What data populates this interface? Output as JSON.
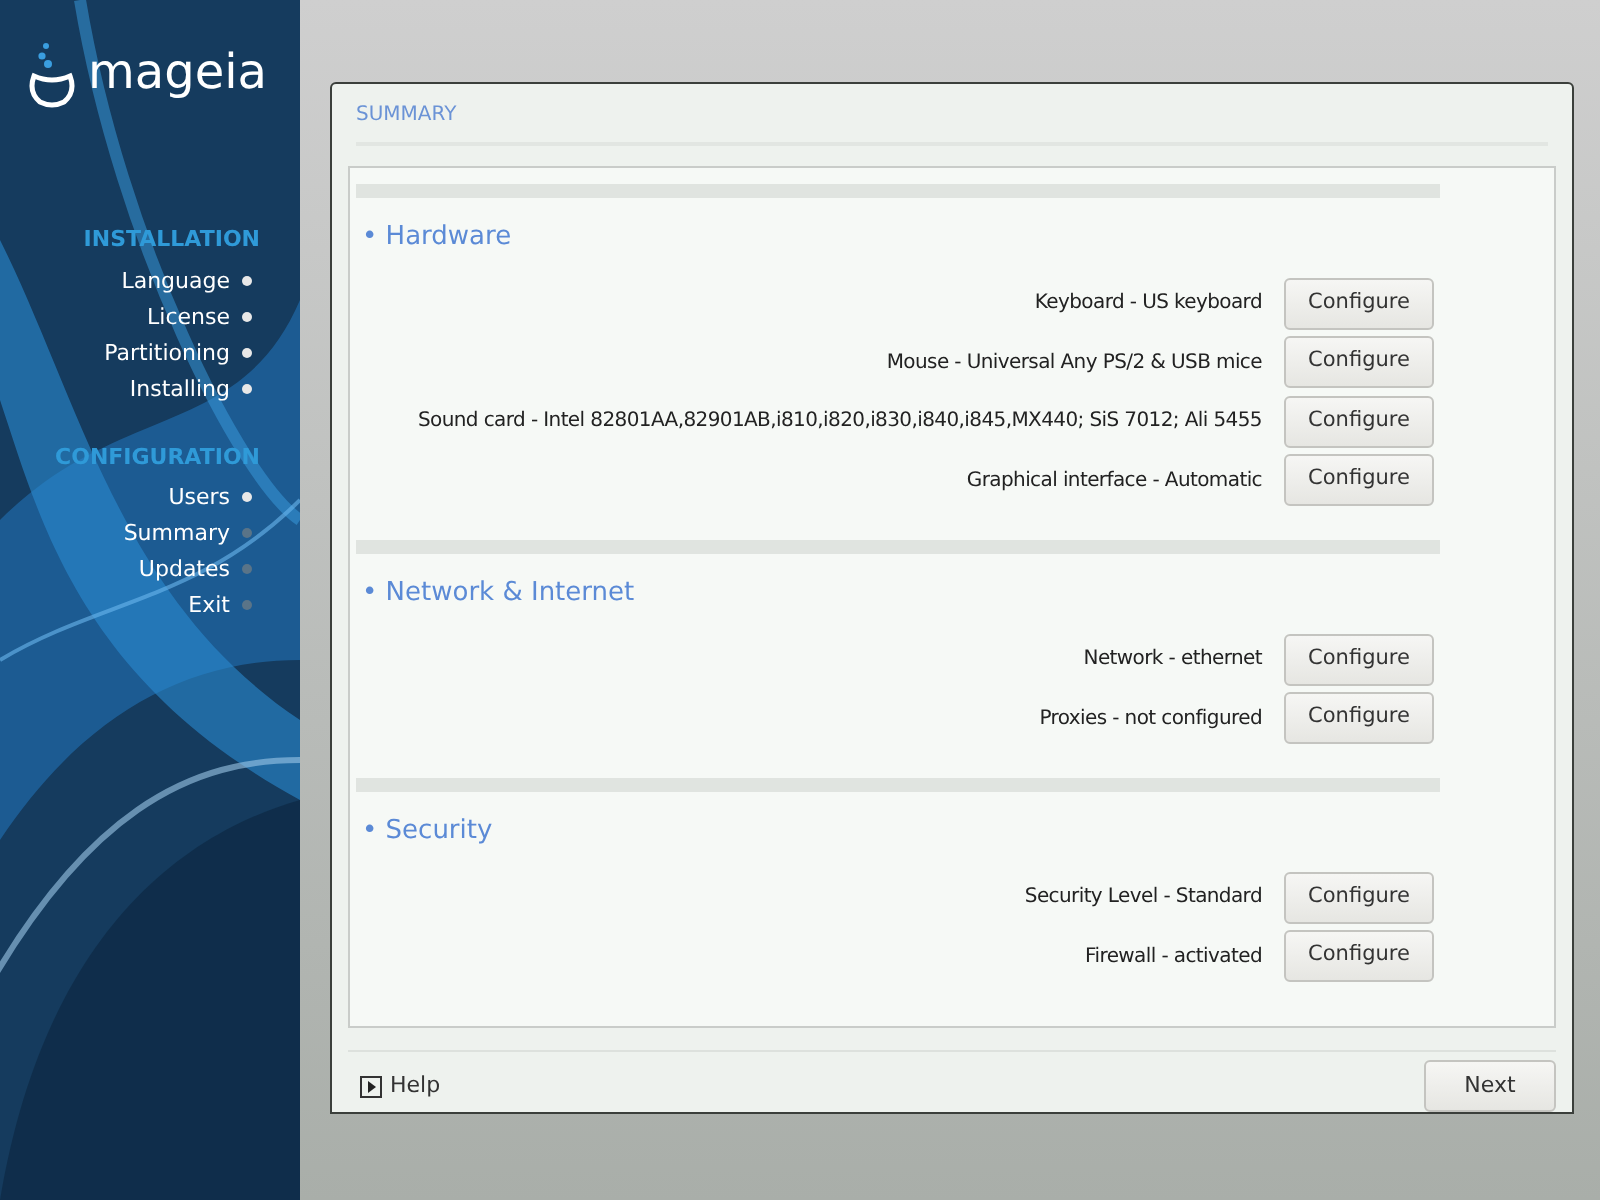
{
  "logo": {
    "text": "mageia"
  },
  "sidebar": {
    "groups": [
      {
        "title": "INSTALLATION",
        "items": [
          {
            "label": "Language",
            "done": true
          },
          {
            "label": "License",
            "done": true
          },
          {
            "label": "Partitioning",
            "done": true
          },
          {
            "label": "Installing",
            "done": true
          }
        ]
      },
      {
        "title": "CONFIGURATION",
        "items": [
          {
            "label": "Users",
            "done": true
          },
          {
            "label": "Summary",
            "done": false
          },
          {
            "label": "Updates",
            "done": false
          },
          {
            "label": "Exit",
            "done": false
          }
        ]
      }
    ]
  },
  "dialog": {
    "title": "SUMMARY",
    "sections": [
      {
        "title": "• Hardware",
        "rows": [
          {
            "label": "Keyboard - US keyboard",
            "button": "Configure"
          },
          {
            "label": "Mouse - Universal Any PS/2 & USB mice",
            "button": "Configure"
          },
          {
            "label": "Sound card - Intel 82801AA,82901AB,i810,i820,i830,i840,i845,MX440; SiS 7012; Ali 5455",
            "button": "Configure"
          },
          {
            "label": "Graphical interface - Automatic",
            "button": "Configure"
          }
        ]
      },
      {
        "title": "• Network & Internet",
        "rows": [
          {
            "label": "Network - ethernet",
            "button": "Configure"
          },
          {
            "label": "Proxies - not configured",
            "button": "Configure"
          }
        ]
      },
      {
        "title": "• Security",
        "rows": [
          {
            "label": "Security Level - Standard",
            "button": "Configure"
          },
          {
            "label": "Firewall - activated",
            "button": "Configure"
          }
        ]
      }
    ],
    "help": "Help",
    "next": "Next"
  }
}
